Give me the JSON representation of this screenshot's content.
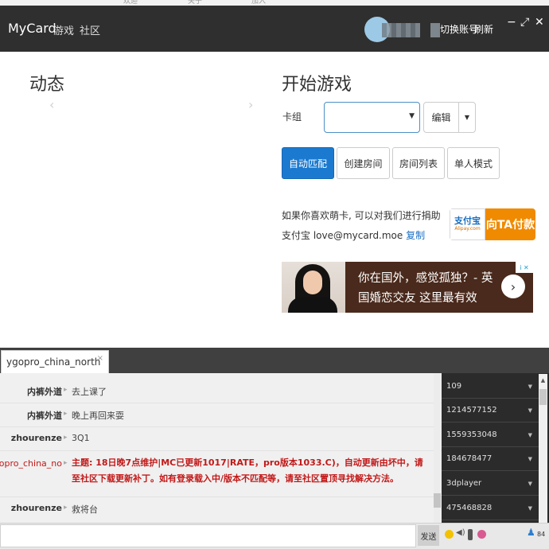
{
  "top_strip": [
    "欢迎",
    "关于",
    "加入"
  ],
  "header": {
    "brand": "MyCard",
    "nav": [
      "游戏",
      "社区"
    ],
    "switch_account": "切换账号",
    "refresh": "刷新",
    "window_buttons": {
      "minimize": "−",
      "maximize": "⤢",
      "close": "✕"
    }
  },
  "left": {
    "title": "动态",
    "prev_arrow": "‹",
    "next_arrow": "›"
  },
  "right": {
    "title": "开始游戏",
    "deck_label": "卡组",
    "deck_value": "",
    "edit_label": "编辑",
    "modes": [
      "自动匹配",
      "创建房间",
      "房间列表",
      "单人模式"
    ],
    "active_mode": "自动匹配",
    "donate_line1": "如果你喜欢萌卡, 可以对我们进行捐助",
    "donate_line2": "支付宝 love@mycard.moe",
    "copy": "复制",
    "alipay_logo": "支付宝",
    "alipay_logo_sub": "Alipay.com",
    "alipay_pay": "向TA付款"
  },
  "ad": {
    "line1": "你在国外，感觉孤独？- 英",
    "line2": "国婚恋交友 这里最有效",
    "badge": "i ✕",
    "next": "›"
  },
  "chat": {
    "tab": "ygopro_china_north",
    "tab_close": "×",
    "messages": [
      {
        "sender": "内裤外道",
        "text": "去上课了",
        "system": false
      },
      {
        "sender": "内裤外道",
        "text": "晚上再回来耍",
        "system": false
      },
      {
        "sender": "zhourenze",
        "text": "3Q1",
        "system": false
      },
      {
        "sender": "ygopro_china_no",
        "text": "主题: 18日晚7点维护|MC已更新1017|RATE，pro版本1033.C)，自动更新由坏中，请至社区下载更新补丁。如有登录载入中/版本不匹配等，请至社区置顶寻找解决方法。",
        "system": true
      },
      {
        "sender": "zhourenze",
        "text": "救将台",
        "system": false
      }
    ],
    "users": [
      "109",
      "1214577152",
      "1559353048",
      "184678477",
      "3dplayer",
      "475468828"
    ],
    "send": "发送",
    "user_count": "84"
  },
  "colors": {
    "accent": "#1b7ad0",
    "header": "#2f2f2f",
    "system_msg": "#c21818",
    "alipay": "#f08a00"
  }
}
